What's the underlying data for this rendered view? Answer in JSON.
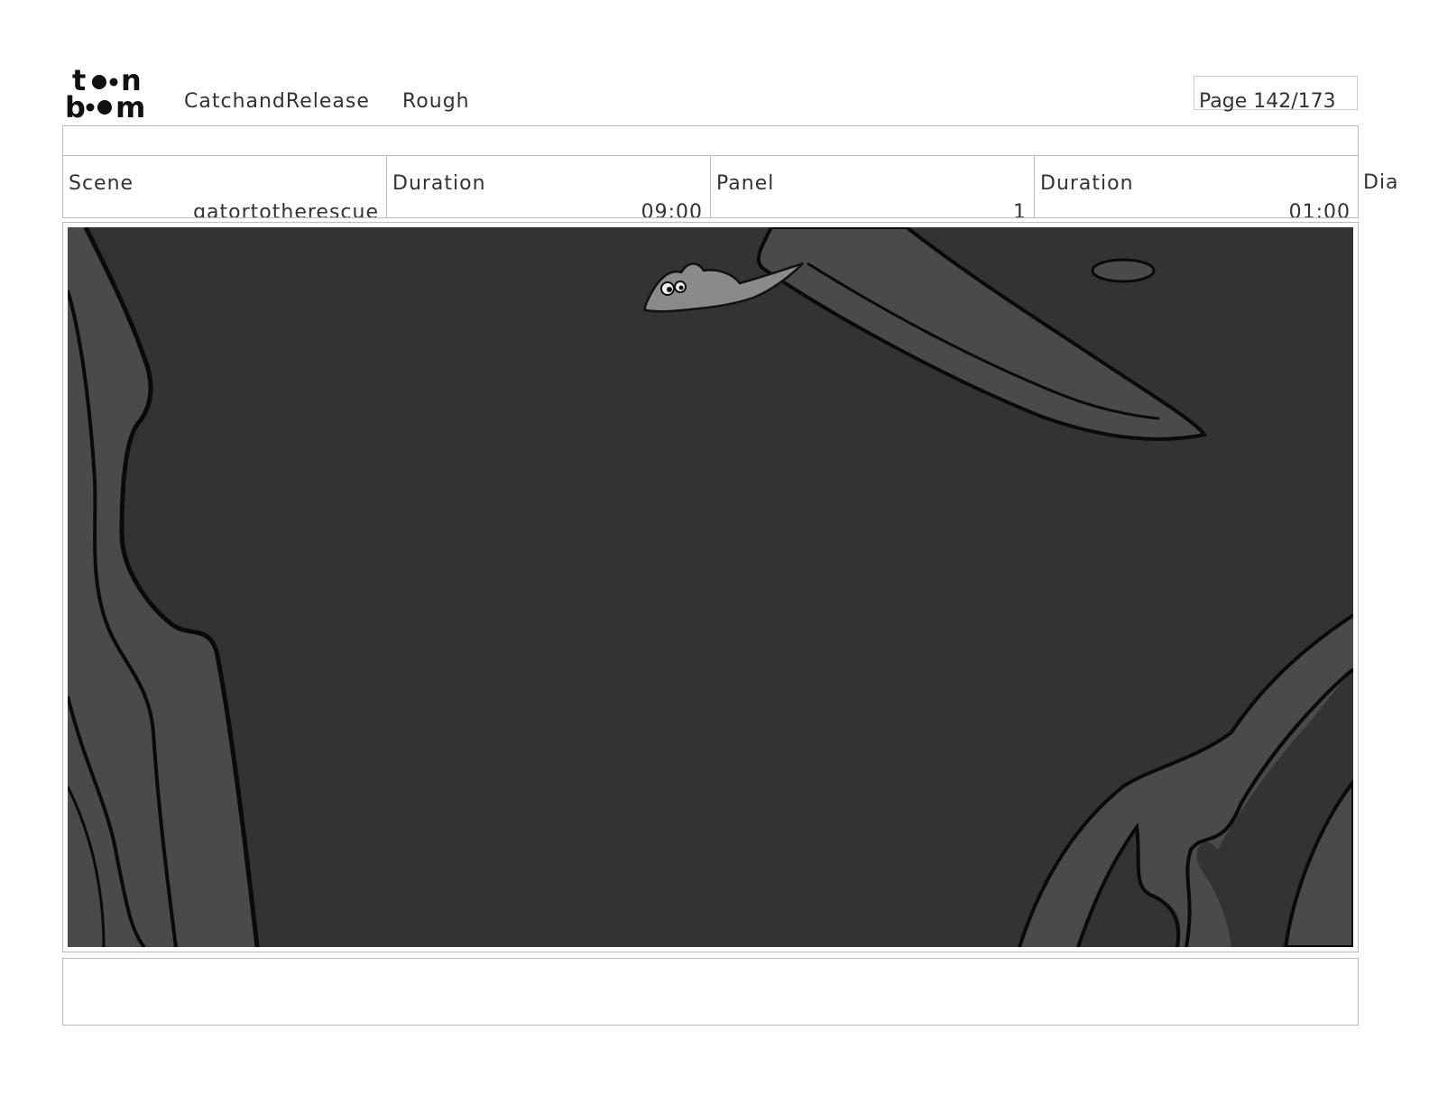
{
  "header": {
    "logo_icon": "toon-boom-logo-icon",
    "project": "CatchandRelease",
    "stage": "Rough",
    "page": "Page 142/173"
  },
  "info": {
    "scene_label": "Scene",
    "scene_value": "gatortotherescue",
    "scene_duration_label": "Duration",
    "scene_duration_value": "09:00",
    "panel_label": "Panel",
    "panel_value": "1",
    "panel_duration_label": "Duration",
    "panel_duration_value": "01:00",
    "dialogue_label": "Dia"
  },
  "panel": {
    "background_color": "#333333",
    "shape_color": "#4a4a4a",
    "outline_color": "#0a0a0a",
    "character_icon": "fish-character-icon"
  },
  "notes": {
    "text": ""
  }
}
